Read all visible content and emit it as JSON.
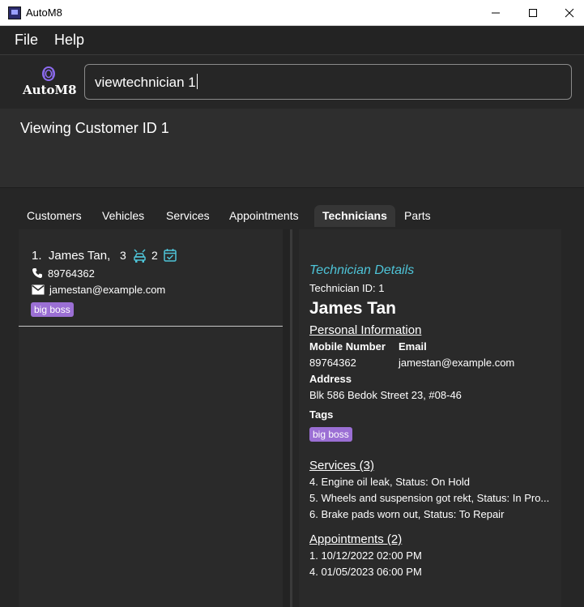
{
  "window": {
    "title": "AutoM8"
  },
  "menu": {
    "file": "File",
    "help": "Help"
  },
  "logo": {
    "text": "AutoM8"
  },
  "command": {
    "value": "viewtechnician 1"
  },
  "result": {
    "text": "Viewing Customer ID 1"
  },
  "tabs": [
    {
      "label": "Customers"
    },
    {
      "label": "Vehicles"
    },
    {
      "label": "Services"
    },
    {
      "label": "Appointments"
    },
    {
      "label": "Technicians",
      "active": true
    },
    {
      "label": "Parts"
    }
  ],
  "list": {
    "items": [
      {
        "index": "1.",
        "name": "James Tan,",
        "service_count": "3",
        "appointment_count": "2",
        "phone": "89764362",
        "email": "jamestan@example.com",
        "tag": "big boss"
      }
    ]
  },
  "details": {
    "heading": "Technician Details",
    "id_line": "Technician ID: 1",
    "name": "James Tan",
    "personal_section": "Personal Information",
    "mobile_label": "Mobile Number",
    "mobile_value": "89764362",
    "email_label": "Email",
    "email_value": "jamestan@example.com",
    "address_label": "Address",
    "address_value": "Blk 586 Bedok Street 23, #08-46",
    "tags_label": "Tags",
    "tag": "big boss",
    "services_section": "Services (3)",
    "services": [
      "4. Engine oil leak, Status: On Hold",
      "5. Wheels and suspension got rekt, Status: In Pro...",
      "6. Brake pads worn out, Status: To Repair"
    ],
    "appointments_section": "Appointments (2)",
    "appointments": [
      "1. 10/12/2022 02:00 PM",
      "4. 01/05/2023 06:00 PM"
    ]
  },
  "colors": {
    "accent_cyan": "#4ec4d8",
    "tag_purple": "#9b6fd4",
    "logo_purple": "#8c6bf0",
    "background": "#262626"
  },
  "icons": {
    "app": "app-icon",
    "minimize": "minimize-icon",
    "maximize": "maximize-icon",
    "close": "close-icon",
    "logo_wheel": "wheel-icon",
    "services": "car-service-icon",
    "appointments": "calendar-check-icon",
    "phone": "phone-icon",
    "email": "envelope-icon"
  }
}
